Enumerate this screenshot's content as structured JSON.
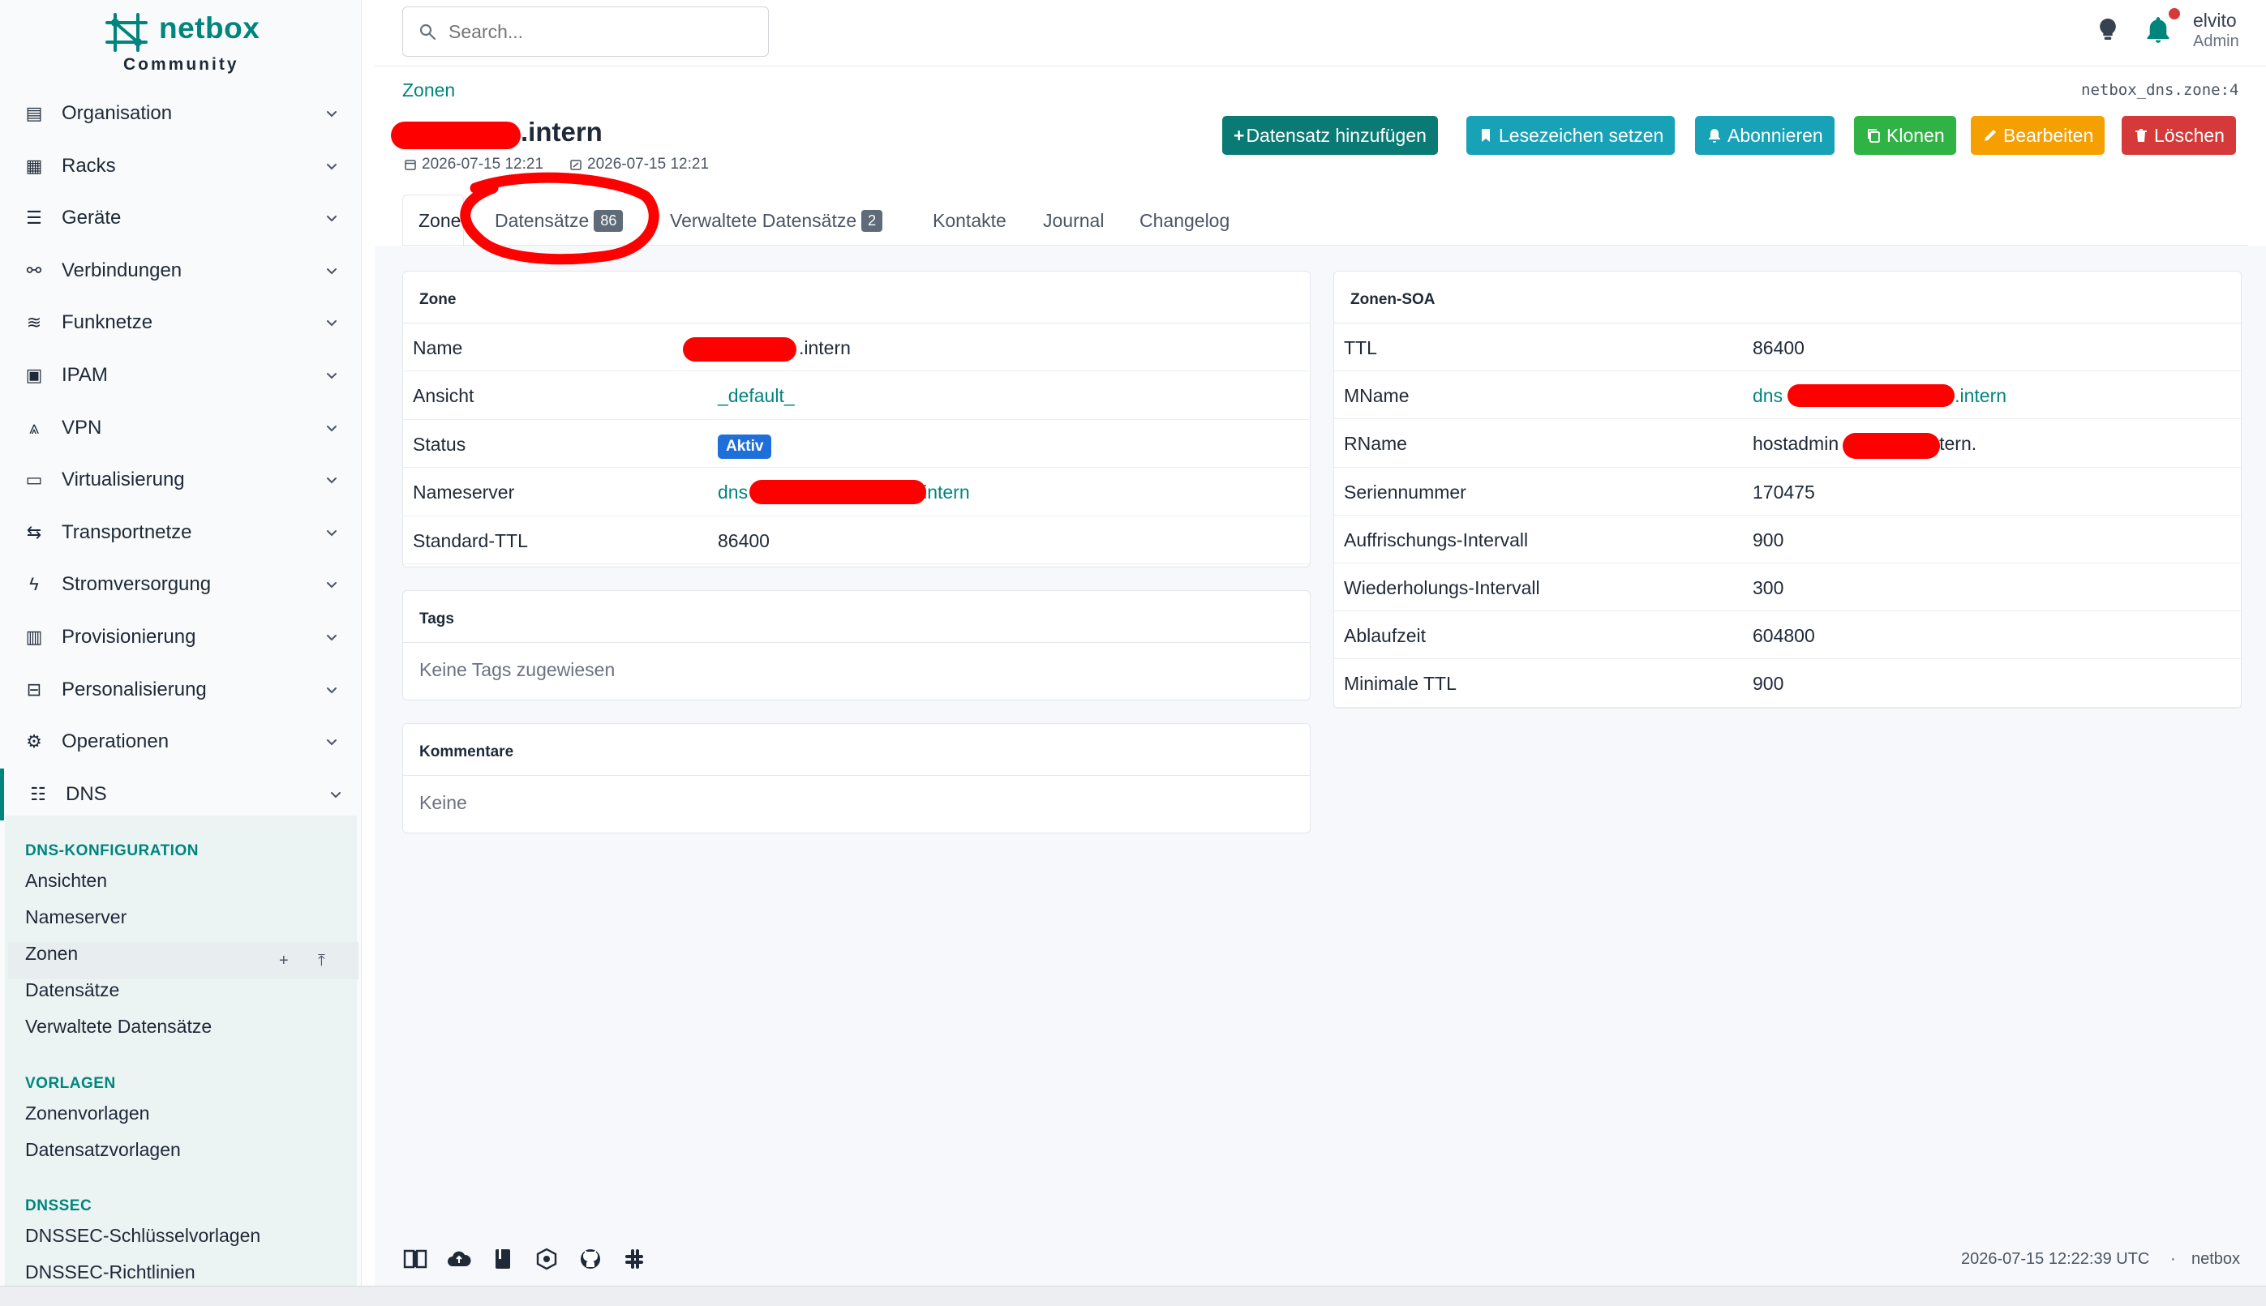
{
  "brand": {
    "name": "netbox",
    "edition": "Community"
  },
  "sidebar": {
    "items": [
      {
        "label": "Organisation",
        "icon": "building-icon"
      },
      {
        "label": "Racks",
        "icon": "rack-icon"
      },
      {
        "label": "Geräte",
        "icon": "server-icon"
      },
      {
        "label": "Verbindungen",
        "icon": "cable-icon"
      },
      {
        "label": "Funknetze",
        "icon": "wifi-icon"
      },
      {
        "label": "IPAM",
        "icon": "counter-icon"
      },
      {
        "label": "VPN",
        "icon": "tunnel-icon"
      },
      {
        "label": "Virtualisierung",
        "icon": "monitor-icon"
      },
      {
        "label": "Transportnetze",
        "icon": "transit-icon"
      },
      {
        "label": "Stromversorgung",
        "icon": "flash-icon"
      },
      {
        "label": "Provisionierung",
        "icon": "file-document-icon"
      },
      {
        "label": "Personalisierung",
        "icon": "toolbox-icon"
      },
      {
        "label": "Operationen",
        "icon": "cogs-icon"
      },
      {
        "label": "DNS",
        "icon": "dns-icon"
      }
    ],
    "dns_sections": [
      {
        "heading": "DNS-KONFIGURATION",
        "items": [
          "Ansichten",
          "Nameserver",
          "Zonen",
          "Datensätze",
          "Verwaltete Datensätze"
        ]
      },
      {
        "heading": "VORLAGEN",
        "items": [
          "Zonenvorlagen",
          "Datensatzvorlagen"
        ]
      },
      {
        "heading": "DNSSEC",
        "items": [
          "DNSSEC-Schlüsselvorlagen",
          "DNSSEC-Richtlinien"
        ]
      }
    ],
    "active_item": "Zonen",
    "add_symbol": "+",
    "import_symbol": "⤒"
  },
  "topbar": {
    "search_placeholder": "Search...",
    "user_name": "elvito",
    "user_role": "Admin"
  },
  "header": {
    "breadcrumb": "Zonen",
    "object_id": "netbox_dns.zone:4",
    "title": ".intern",
    "created": "2026-07-15 12:21",
    "updated": "2026-07-15 12:21"
  },
  "buttons": {
    "add_record": "Datensatz hinzufügen",
    "bookmark": "Lesezeichen setzen",
    "subscribe": "Abonnieren",
    "clone": "Klonen",
    "edit": "Bearbeiten",
    "delete": "Löschen"
  },
  "colors": {
    "accent": "#00857d",
    "add": "#0a7b74",
    "info": "#17a2b8",
    "green": "#2fb344",
    "orange": "#f59f00",
    "red": "#d63939",
    "status_blue": "#1e6fd9"
  },
  "tabs": [
    {
      "label": "Zone"
    },
    {
      "label": "Datensätze",
      "badge": "86"
    },
    {
      "label": "Verwaltete Datensätze",
      "badge": "2"
    },
    {
      "label": "Kontakte"
    },
    {
      "label": "Journal"
    },
    {
      "label": "Changelog"
    }
  ],
  "zone_card": {
    "title": "Zone",
    "rows": [
      {
        "key": "Name",
        "value": ".intern"
      },
      {
        "key": "Ansicht",
        "value": "_default_"
      },
      {
        "key": "Status",
        "value": "Aktiv"
      },
      {
        "key": "Nameserver",
        "value_prefix": "dns",
        "value_suffix": "intern"
      },
      {
        "key": "Standard-TTL",
        "value": "86400"
      }
    ]
  },
  "tags_card": {
    "title": "Tags",
    "empty": "Keine Tags zugewiesen"
  },
  "comments_card": {
    "title": "Kommentare",
    "empty": "Keine"
  },
  "soa_card": {
    "title": "Zonen-SOA",
    "rows": [
      {
        "key": "TTL",
        "value": "86400"
      },
      {
        "key": "MName",
        "value_prefix": "dns",
        "value_suffix": ".intern"
      },
      {
        "key": "RName",
        "value_prefix": "hostadmin",
        "value_suffix": "tern."
      },
      {
        "key": "Seriennummer",
        "value": "170475"
      },
      {
        "key": "Auffrischungs-Intervall",
        "value": "900"
      },
      {
        "key": "Wiederholungs-Intervall",
        "value": "300"
      },
      {
        "key": "Ablaufzeit",
        "value": "604800"
      },
      {
        "key": "Minimale TTL",
        "value": "900"
      }
    ]
  },
  "footer": {
    "timestamp": "2026-07-15 12:22:39 UTC",
    "separator": "·",
    "instance": "netbox",
    "icons": [
      "book-icon",
      "cloud-icon",
      "notebook-icon",
      "api-icon",
      "github-icon",
      "slack-icon"
    ]
  }
}
